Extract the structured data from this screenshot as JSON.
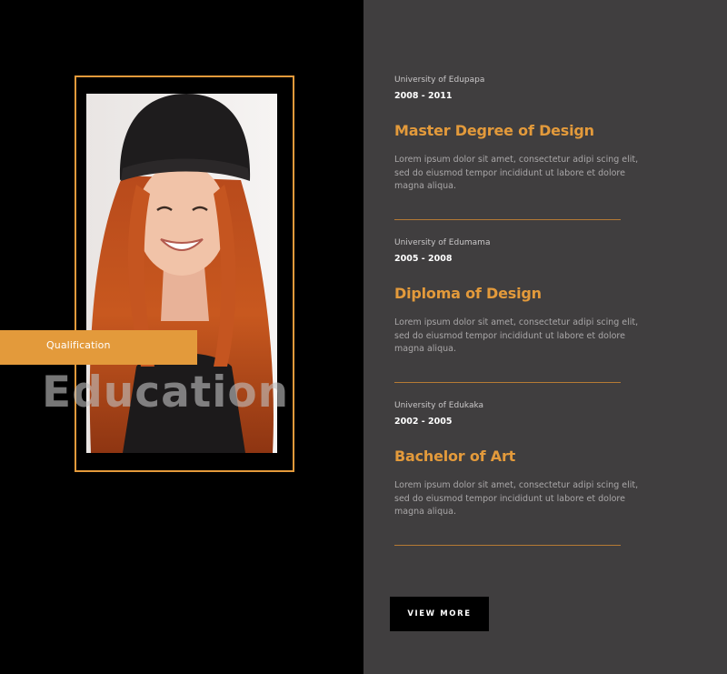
{
  "hero": {
    "qualification_label": "Qualification",
    "title": "Education"
  },
  "education": [
    {
      "university": "University of Edupapa",
      "years": "2008 - 2011",
      "degree": "Master Degree of Design",
      "description": "Lorem ipsum dolor sit amet, consectetur adipi scing elit, sed do eiusmod tempor incididunt ut labore et dolore magna aliqua."
    },
    {
      "university": "University of Edumama",
      "years": "2005 - 2008",
      "degree": "Diploma of Design",
      "description": "Lorem ipsum dolor sit amet, consectetur adipi scing elit, sed do eiusmod tempor incididunt ut labore et dolore magna aliqua."
    },
    {
      "university": "University of Edukaka",
      "years": "2002 - 2005",
      "degree": "Bachelor of Art",
      "description": "Lorem ipsum dolor sit amet, consectetur adipi scing elit, sed do eiusmod tempor incididunt ut labore et dolore magna aliqua."
    }
  ],
  "actions": {
    "view_more_label": "VIEW MORE"
  },
  "colors": {
    "accent": "#e39a3b",
    "left_bg": "#000000",
    "right_bg": "#403e3f"
  }
}
